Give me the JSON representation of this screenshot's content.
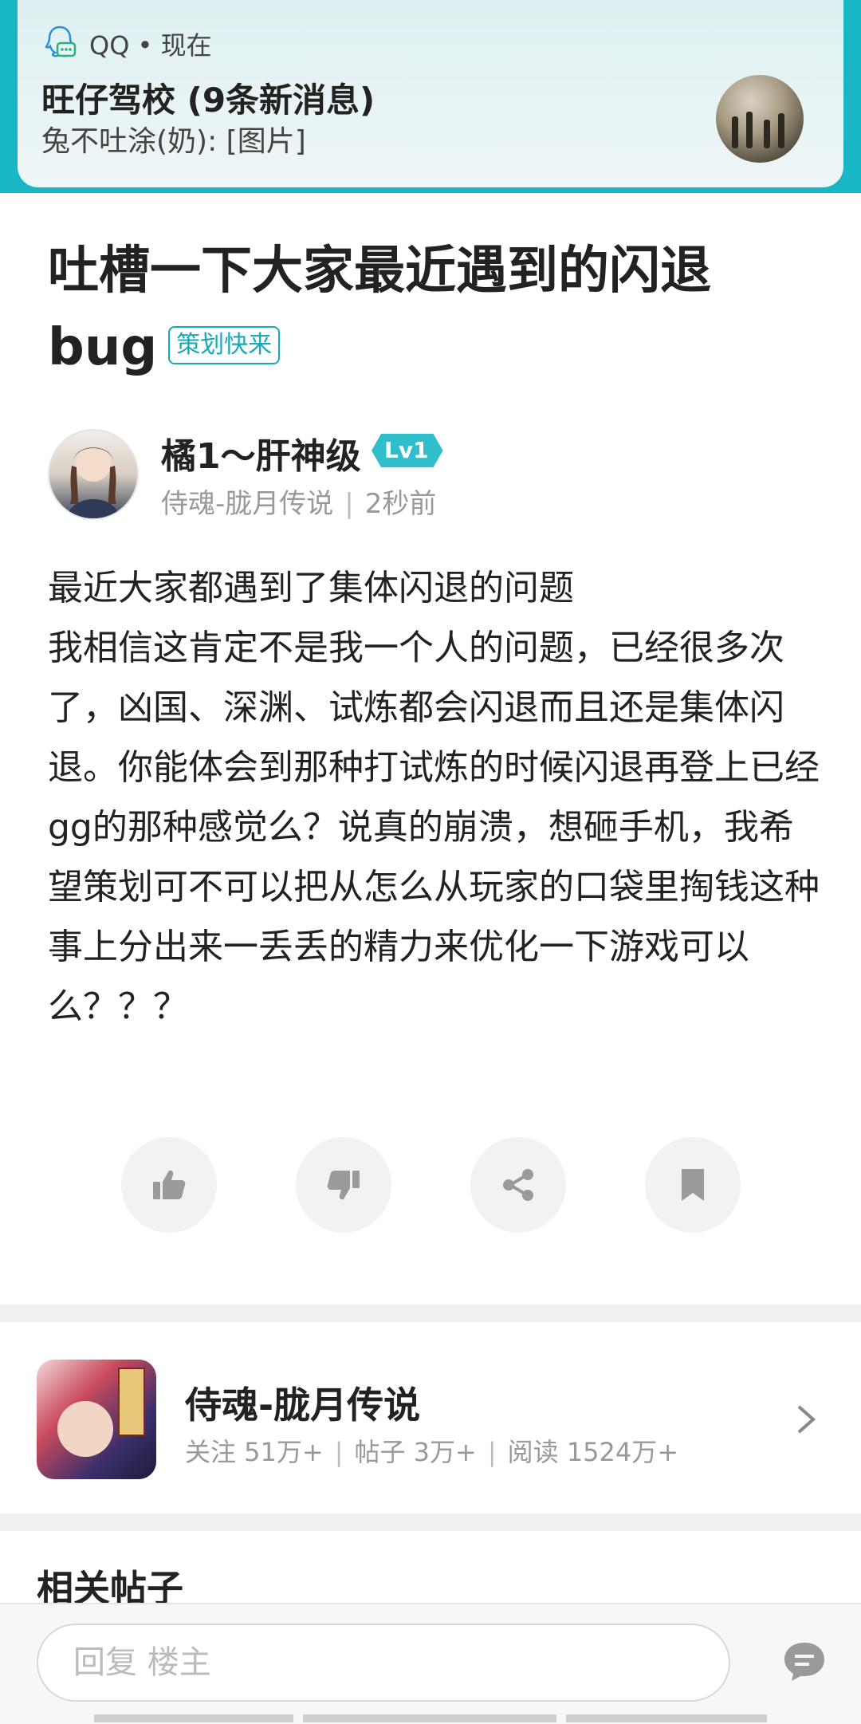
{
  "notification": {
    "app": "QQ",
    "time": "现在",
    "title": "旺仔驾校 (9条新消息)",
    "message": "兔不吐涂(奶): [图片]"
  },
  "post": {
    "title": "吐槽一下大家最近遇到的闪退bug",
    "tag": "策划快来",
    "author": {
      "name": "橘1～肝神级",
      "level": "Lv1",
      "forum": "侍魂-胧月传说",
      "time": "2秒前"
    },
    "content": "最近大家都遇到了集体闪退的问题\n我相信这肯定不是我一个人的问题，已经很多次了，凶国、深渊、试炼都会闪退而且还是集体闪退。你能体会到那种打试炼的时候闪退再登上已经gg的那种感觉么？说真的崩溃，想砸手机，我希望策划可不可以把从怎么从玩家的口袋里掏钱这种事上分出来一丢丢的精力来优化一下游戏可以么？？？"
  },
  "actions": [
    "thumbs-up-icon",
    "thumbs-down-icon",
    "share-icon",
    "bookmark-icon"
  ],
  "forum": {
    "name": "侍魂-胧月传说",
    "stats": {
      "follow": "关注 51万+",
      "posts": "帖子 3万+",
      "reads": "阅读 1524万+"
    }
  },
  "related": {
    "title": "相关帖子"
  },
  "reply": {
    "placeholder": "回复  楼主"
  },
  "colors": {
    "accent": "#19b7c5",
    "tag": "#16a9b8"
  }
}
